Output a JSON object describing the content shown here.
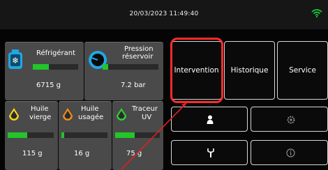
{
  "header": {
    "datetime": "20/03/2023 11:49:40",
    "wifi_icon": "wifi-icon",
    "wifi_color": "#17d43a"
  },
  "tiles": {
    "refrigerant": {
      "label": "Réfrigérant",
      "value": "6715 g",
      "level": 0.35,
      "icon": "refrigerant-tank-icon"
    },
    "pressure": {
      "label_line1": "Pression",
      "label_line2": "réservoir",
      "value": "7.2 bar",
      "level": 0.1,
      "icon": "pressure-gauge-icon"
    },
    "virgin_oil": {
      "label_line1": "Huile",
      "label_line2": "vierge",
      "value": "115 g",
      "level": 0.42,
      "icon": "yellow-drop-icon"
    },
    "used_oil": {
      "label_line1": "Huile",
      "label_line2": "usagée",
      "value": "16 g",
      "level": 0.06,
      "icon": "orange-drop-icon"
    },
    "uv_tracer": {
      "label_line1": "Traceur",
      "label_line2": "UV",
      "value": "75 g",
      "level": 0.43,
      "icon": "green-drop-icon"
    }
  },
  "buttons": {
    "intervention": "Intervention",
    "historique": "Historique",
    "service": "Service",
    "user_icon": "user-icon",
    "settings_icon": "settings-icon",
    "tools_icon": "tools-icon",
    "info_icon": "info-icon"
  },
  "colors": {
    "accent_green": "#22c52a",
    "highlight_red": "#ff2a2a",
    "tile_bg": "#4a4a4a"
  }
}
